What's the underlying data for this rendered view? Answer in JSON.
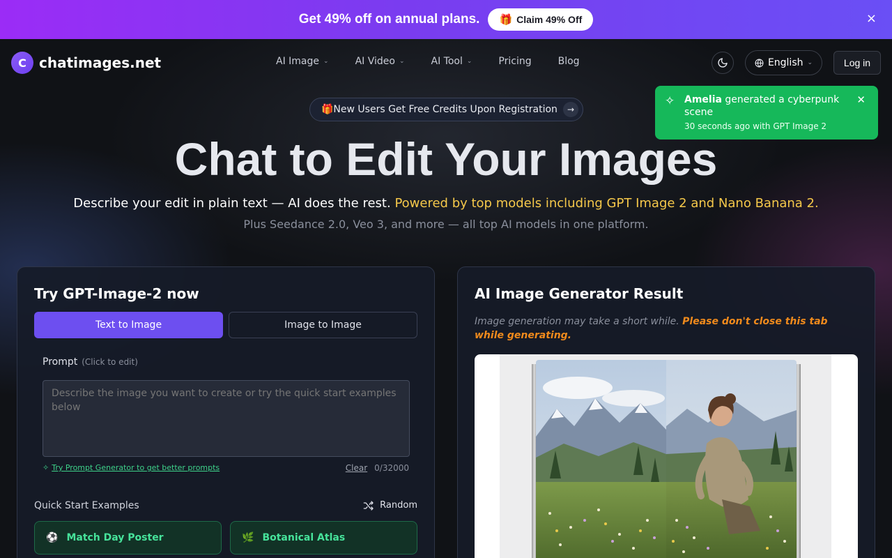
{
  "promo": {
    "text": "Get 49% off on annual plans.",
    "button_label": "Claim 49% Off",
    "close_icon": "×"
  },
  "header": {
    "logo_letter": "C",
    "logo_text": "chatimages.net",
    "nav": [
      {
        "label": "AI Image",
        "dropdown": true
      },
      {
        "label": "AI Video",
        "dropdown": true
      },
      {
        "label": "AI Tool",
        "dropdown": true
      },
      {
        "label": "Pricing",
        "dropdown": false
      },
      {
        "label": "Blog",
        "dropdown": false
      }
    ],
    "theme_icon": "moon-icon",
    "language": "English",
    "login_label": "Log in"
  },
  "toast": {
    "name": "Amelia",
    "message": " generated a cyberpunk scene",
    "sub": "30 seconds ago with GPT Image 2"
  },
  "hero": {
    "pill": "🎁New Users Get Free Credits Upon Registration",
    "title": "Chat to Edit Your Images",
    "subtitle_white": "Describe your edit in plain text — AI does the rest.",
    "subtitle_yellow": " Powered by top models including GPT Image 2 and Nano Banana 2.",
    "subtitle2": "Plus Seedance 2.0, Veo 3, and more — all top AI models in one platform."
  },
  "left_panel": {
    "title": "Try GPT-Image-2 now",
    "tabs": [
      "Text to Image",
      "Image to Image"
    ],
    "prompt_label": "Prompt",
    "prompt_hint": "(Click to edit)",
    "prompt_placeholder": "Describe the image you want to create or try the quick start examples below",
    "generator_link": "Try Prompt Generator to get better prompts",
    "clear_label": "Clear",
    "char_count": "0/32000",
    "quick_start_label": "Quick Start Examples",
    "random_label": "Random",
    "examples": [
      {
        "emoji": "⚽",
        "label": "Match Day Poster"
      },
      {
        "emoji": "🌿",
        "label": "Botanical Atlas"
      }
    ]
  },
  "right_panel": {
    "title": "AI Image Generator Result",
    "note_plain": "Image generation may take a short while. ",
    "note_bold": "Please don't close this tab while generating."
  },
  "colors": {
    "accent": "#6d4ff0",
    "toast": "#16b85a",
    "highlight": "#f5c84a",
    "warning": "#f08a1c"
  }
}
